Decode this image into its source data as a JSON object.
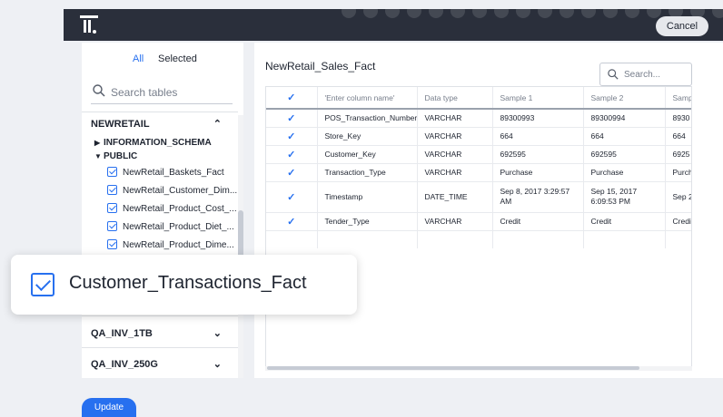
{
  "topbar": {
    "cancel_label": "Cancel"
  },
  "left": {
    "tabs": {
      "all": "All",
      "selected": "Selected"
    },
    "search_placeholder": "Search tables",
    "database": "NEWRETAIL",
    "schemas": {
      "info": "INFORMATION_SCHEMA",
      "public": "PUBLIC"
    },
    "tables": [
      "NewRetail_Baskets_Fact",
      "NewRetail_Customer_Dim...",
      "NewRetail_Product_Cost_...",
      "NewRetail_Product_Diet_...",
      "NewRetail_Product_Dime..."
    ],
    "other_dbs": [
      "QA_INV_1TB",
      "QA_INV_250G"
    ]
  },
  "right": {
    "table_title": "NewRetail_Sales_Fact",
    "search_placeholder": "Search...",
    "columns": [
      "'Enter column name'",
      "Data type",
      "Sample 1",
      "Sample 2",
      "Samp"
    ],
    "rows": [
      [
        "POS_Transaction_Number",
        "VARCHAR",
        "89300993",
        "89300994",
        "8930"
      ],
      [
        "Store_Key",
        "VARCHAR",
        "664",
        "664",
        "664"
      ],
      [
        "Customer_Key",
        "VARCHAR",
        "692595",
        "692595",
        "6925"
      ],
      [
        "Transaction_Type",
        "VARCHAR",
        "Purchase",
        "Purchase",
        "Purch"
      ],
      [
        "Timestamp",
        "DATE_TIME",
        "Sep 8, 2017 3:29:57 AM",
        "Sep 15, 2017 6:09:53 PM",
        "Sep 2 PM"
      ],
      [
        "Tender_Type",
        "VARCHAR",
        "Credit",
        "Credit",
        "Credi"
      ]
    ]
  },
  "popup": {
    "label": "Customer_Transactions_Fact"
  },
  "footer": {
    "update_label": "Update"
  },
  "colors": {
    "accent": "#2770ef",
    "topbar": "#2a2f3b"
  }
}
